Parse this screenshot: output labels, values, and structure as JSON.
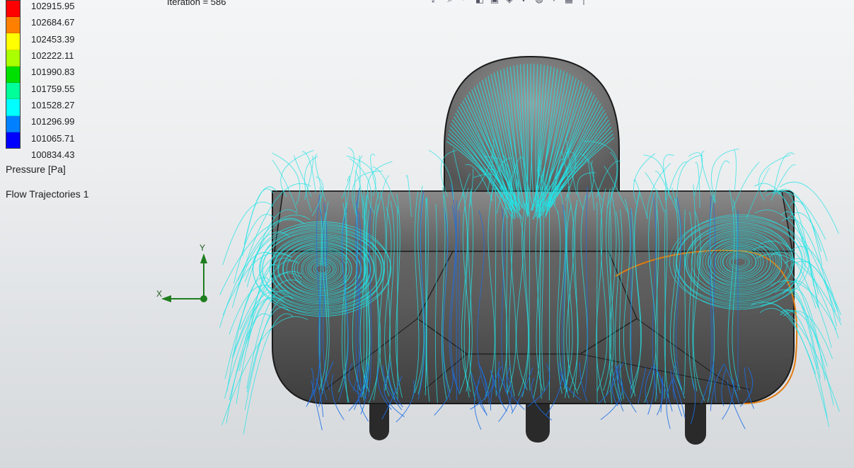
{
  "iteration_text": "Iteration = 586",
  "legend": {
    "title": "Pressure [Pa]",
    "values": [
      "102915.95",
      "102684.67",
      "102453.39",
      "102222.11",
      "101990.83",
      "101759.55",
      "101528.27",
      "101296.99",
      "101065.71",
      "100834.43"
    ],
    "colors": [
      "#ff0000",
      "#ff8000",
      "#ffff00",
      "#aaff00",
      "#00e000",
      "#00ff99",
      "#00ffff",
      "#0080ff",
      "#0000ff"
    ]
  },
  "plot_name": "Flow Trajectories 1",
  "triad": {
    "x_label": "X",
    "y_label": "Y"
  },
  "toolbar": {
    "icons": [
      "zoom-fit-icon",
      "zoom-area-icon",
      "previous-view-icon",
      "section-view-icon",
      "view-orientation-icon",
      "display-style-icon",
      "hide-show-icon",
      "edit-appearance-icon",
      "scene-icon",
      "view-settings-icon",
      "monitor-icon"
    ]
  },
  "colors": {
    "trajectory": "#22e3e6",
    "trajectory_low": "#1a6fe6",
    "body": "#5a5a5a",
    "highlight_edge": "#e07a10"
  }
}
